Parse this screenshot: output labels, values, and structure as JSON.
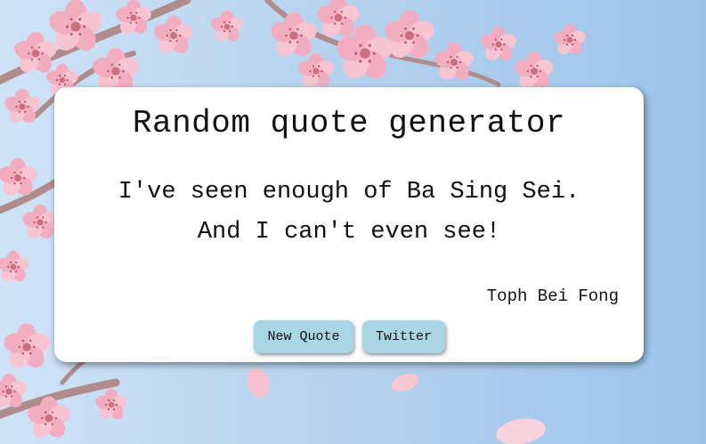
{
  "page": {
    "title": "Random quote generator"
  },
  "quote": {
    "text": "I've seen enough of Ba Sing Sei. And I can't even see!",
    "line1": "I've seen enough of Ba Sing Sei.",
    "line2": "And I can't even see!",
    "author": "Toph Bei Fong"
  },
  "buttons": {
    "new_quote": "New Quote",
    "twitter": "Twitter"
  },
  "colors": {
    "background_sky": "#a9cbec",
    "blossom_pink": "#f4b6c6",
    "branch": "#a77f7f",
    "card": "#ffffff",
    "button": "#a9d6e2"
  },
  "icons": {
    "background": "cherry-blossom-branches-illustration"
  }
}
